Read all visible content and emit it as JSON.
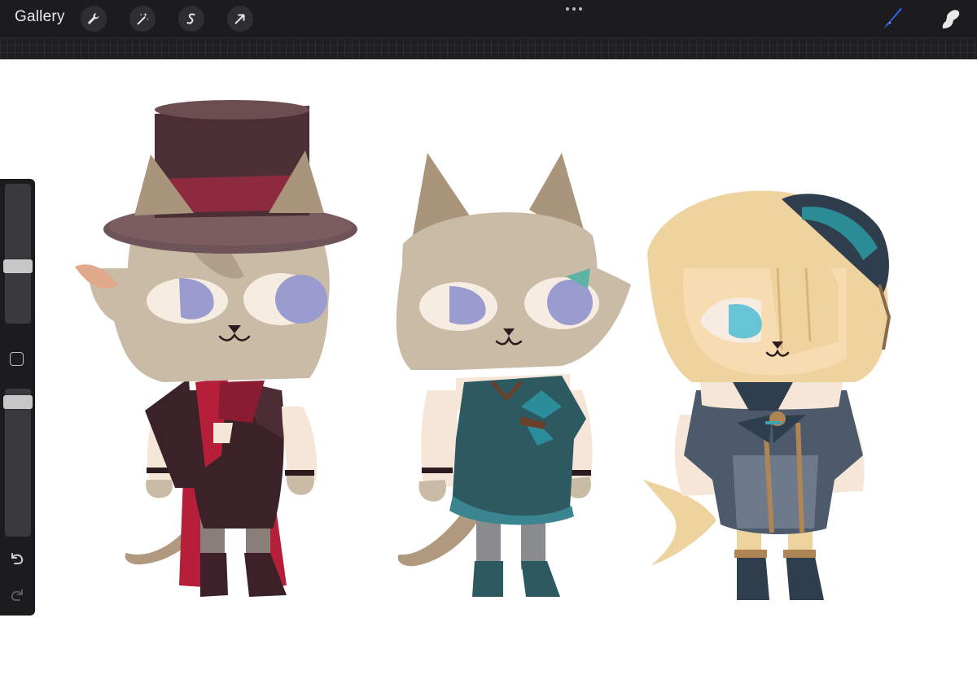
{
  "toolbar": {
    "gallery_label": "Gallery",
    "left_tools": [
      "wrench-icon",
      "magic-wand-icon",
      "selection-icon",
      "transform-arrow-icon"
    ],
    "more_icon": "ellipsis-icon",
    "right_tools": [
      "brush-icon",
      "smudge-icon"
    ],
    "active_tool_color": "#2f6bff"
  },
  "sidebar": {
    "brush_size_level": 0.4,
    "opacity_level": 0.05,
    "modifier_icon": "square-icon",
    "undo_icon": "undo-icon",
    "redo_icon": "redo-icon"
  },
  "canvas": {
    "background": "#ffffff",
    "characters": [
      "top-hat-cat",
      "teal-dress-cat",
      "blonde-beret-cat"
    ]
  },
  "colors": {
    "toolbar_bg": "#1c1c1e",
    "fur": "#c9bba6",
    "blonde": "#efd39e",
    "hat": "#5a3b3f",
    "red": "#b51f3a",
    "teal": "#2d5961",
    "navy": "#4c5a6c",
    "eye_purple": "#9a9bcf",
    "eye_blue": "#67c4d4"
  }
}
